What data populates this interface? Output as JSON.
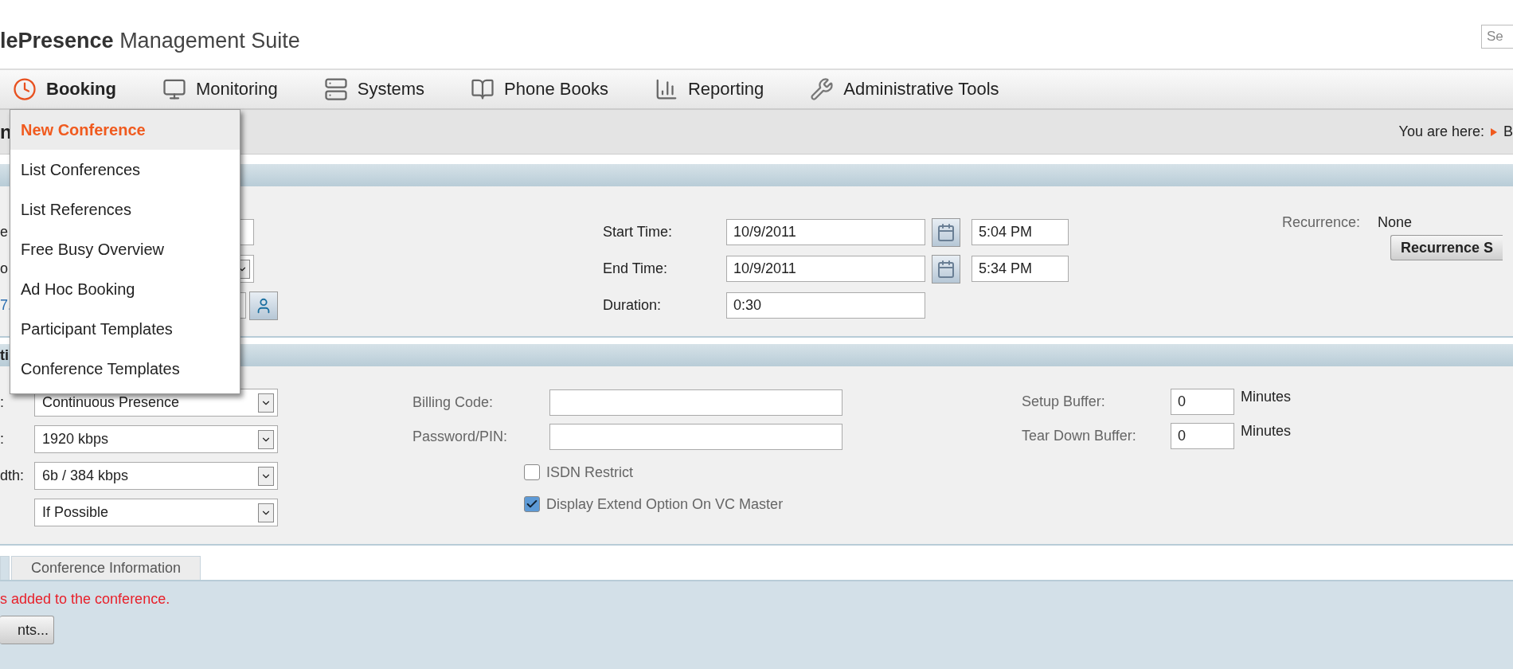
{
  "header": {
    "title_bold": "lePresence",
    "title_rest": "Management Suite",
    "search": {
      "placeholder": "Se"
    }
  },
  "nav": [
    {
      "label": "Booking",
      "selected": true
    },
    {
      "label": "Monitoring",
      "selected": false
    },
    {
      "label": "Systems",
      "selected": false
    },
    {
      "label": "Phone Books",
      "selected": false
    },
    {
      "label": "Reporting",
      "selected": false
    },
    {
      "label": "Administrative Tools",
      "selected": false
    }
  ],
  "booking_menu": [
    {
      "label": "New Conference",
      "selected": true
    },
    {
      "label": "List Conferences",
      "selected": false
    },
    {
      "label": "List References",
      "selected": false
    },
    {
      "label": "Free Busy Overview",
      "selected": false
    },
    {
      "label": "Ad Hoc Booking",
      "selected": false
    },
    {
      "label": "Participant Templates",
      "selected": false
    },
    {
      "label": "Conference Templates",
      "selected": false
    }
  ],
  "subheader": {
    "heading": "n",
    "breadcrumb_label": "You are here:",
    "breadcrumb_item": "B"
  },
  "time_panel": {
    "left_rows": [
      {
        "label": "e",
        "kind": "field"
      },
      {
        "label": "o",
        "kind": "select"
      },
      {
        "label": "7.",
        "kind": "lookup"
      }
    ],
    "start": {
      "label": "Start Time:",
      "date": "10/9/2011",
      "time": "5:04 PM"
    },
    "end": {
      "label": "End Time:",
      "date": "10/9/2011",
      "time": "5:34 PM"
    },
    "duration": {
      "label": "Duration:",
      "value": "0:30"
    },
    "recurrence": {
      "label": "Recurrence:",
      "value": "None",
      "button": "Recurrence S"
    }
  },
  "settings_panel": {
    "section_title": "ti",
    "selects": [
      {
        "label": ":",
        "value": "Continuous Presence"
      },
      {
        "label": ":",
        "value": "1920 kbps"
      },
      {
        "label": "dth:",
        "value": "6b / 384 kbps"
      },
      {
        "value": "If Possible"
      }
    ],
    "billing_code": {
      "label": "Billing Code:"
    },
    "password": {
      "label": "Password/PIN:"
    },
    "checkboxes": [
      {
        "label": "ISDN Restrict",
        "checked": false
      },
      {
        "label": "Display Extend Option On VC Master",
        "checked": true
      }
    ],
    "buffers": [
      {
        "label": "Setup Buffer:",
        "value": "0",
        "unit": "Minutes"
      },
      {
        "label": "Tear Down Buffer:",
        "value": "0",
        "unit": "Minutes"
      }
    ]
  },
  "tabs": [
    {
      "selected": true
    },
    {
      "label": "Conference Information",
      "selected": false
    }
  ],
  "message": "s added to the conference.",
  "participants_button": "nts..."
}
